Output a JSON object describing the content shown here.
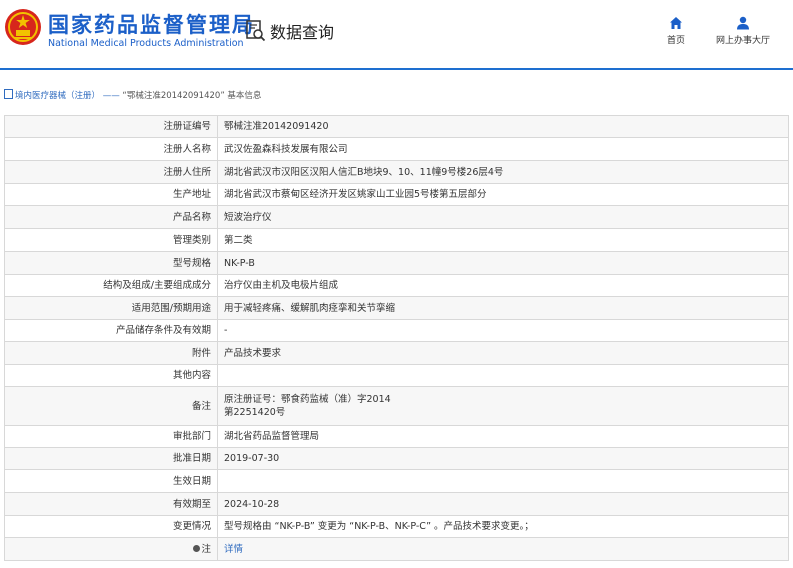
{
  "header": {
    "title_cn": "国家药品监督管理局",
    "title_en": "National Medical Products Administration",
    "section": "数据查询",
    "nav": [
      {
        "label": "首页",
        "icon": "home-icon"
      },
      {
        "label": "网上办事大厅",
        "icon": "user-icon"
      }
    ]
  },
  "breadcrumb": {
    "category": "境内医疗器械（注册）",
    "separator": "——",
    "current": "“鄂械注准20142091420” 基本信息"
  },
  "rows": [
    {
      "label": "注册证编号",
      "value": "鄂械注准20142091420"
    },
    {
      "label": "注册人名称",
      "value": "武汉佐盈森科技发展有限公司"
    },
    {
      "label": "注册人住所",
      "value": "湖北省武汉市汉阳区汉阳人信汇B地块9、10、11幢9号楼26层4号"
    },
    {
      "label": "生产地址",
      "value": "湖北省武汉市蔡甸区经济开发区姚家山工业园5号楼第五层部分"
    },
    {
      "label": "产品名称",
      "value": "短波治疗仪"
    },
    {
      "label": "管理类别",
      "value": "第二类"
    },
    {
      "label": "型号规格",
      "value": "NK-P-B"
    },
    {
      "label": "结构及组成/主要组成成分",
      "value": "治疗仪由主机及电极片组成"
    },
    {
      "label": "适用范围/预期用途",
      "value": "用于减轻疼痛、缓解肌肉痉挛和关节挛缩"
    },
    {
      "label": "产品储存条件及有效期",
      "value": "-"
    },
    {
      "label": "附件",
      "value": "产品技术要求"
    },
    {
      "label": "其他内容",
      "value": ""
    },
    {
      "label": "备注",
      "value_line1": "原注册证号：鄂食药监械（准）字2014",
      "value_line2": "第2251420号"
    },
    {
      "label": "审批部门",
      "value": "湖北省药品监督管理局"
    },
    {
      "label": "批准日期",
      "value": "2019-07-30"
    },
    {
      "label": "生效日期",
      "value": ""
    },
    {
      "label": "有效期至",
      "value": "2024-10-28"
    },
    {
      "label": "变更情况",
      "value": "型号规格由 “NK-P-B” 变更为 “NK-P-B、NK-P-C” 。产品技术要求变更。；"
    },
    {
      "label": "注",
      "value": "详情"
    }
  ],
  "colors": {
    "brand_blue": "#1b5fc8",
    "emblem_red": "#d7261c",
    "link_blue": "#2f6bbf"
  }
}
